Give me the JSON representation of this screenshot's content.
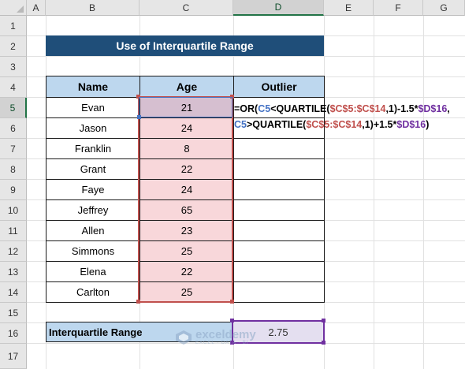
{
  "columns": [
    "A",
    "B",
    "C",
    "D",
    "E",
    "F",
    "G"
  ],
  "rows": [
    "1",
    "2",
    "3",
    "4",
    "5",
    "6",
    "7",
    "8",
    "9",
    "10",
    "11",
    "12",
    "13",
    "14",
    "15",
    "16",
    "17"
  ],
  "title": "Use of Interquartile Range",
  "table_headers": {
    "name": "Name",
    "age": "Age",
    "outlier": "Outlier"
  },
  "table_rows": [
    {
      "name": "Evan",
      "age": "21"
    },
    {
      "name": "Jason",
      "age": "24"
    },
    {
      "name": "Franklin",
      "age": "8"
    },
    {
      "name": "Grant",
      "age": "22"
    },
    {
      "name": "Faye",
      "age": "24"
    },
    {
      "name": "Jeffrey",
      "age": "65"
    },
    {
      "name": "Allen",
      "age": "23"
    },
    {
      "name": "Simmons",
      "age": "25"
    },
    {
      "name": "Elena",
      "age": "22"
    },
    {
      "name": "Carlton",
      "age": "25"
    }
  ],
  "formula": {
    "line1": [
      "=OR(",
      "C5",
      "<QUARTILE(",
      "$C$5:$C$14",
      ",1)-1.5*",
      "$D$16",
      ","
    ],
    "line2": [
      "C5",
      ">QUARTILE(",
      "$C$5:$C$14",
      ",1)+1.5*",
      "$D$16",
      ")"
    ]
  },
  "iqr": {
    "label": "Interquartile Range",
    "value": "2.75"
  },
  "watermark": {
    "brand": "exceldemy",
    "tagline": "EXCEL · DATA · BI"
  },
  "colors": {
    "title_bg": "#1f4e79",
    "header_bg": "#bdd7ee",
    "age_bg": "#f8d7da",
    "ref_blue": "#4472c4",
    "ref_red": "#c0504d",
    "ref_purple": "#7030a0",
    "select_green": "#217346"
  }
}
